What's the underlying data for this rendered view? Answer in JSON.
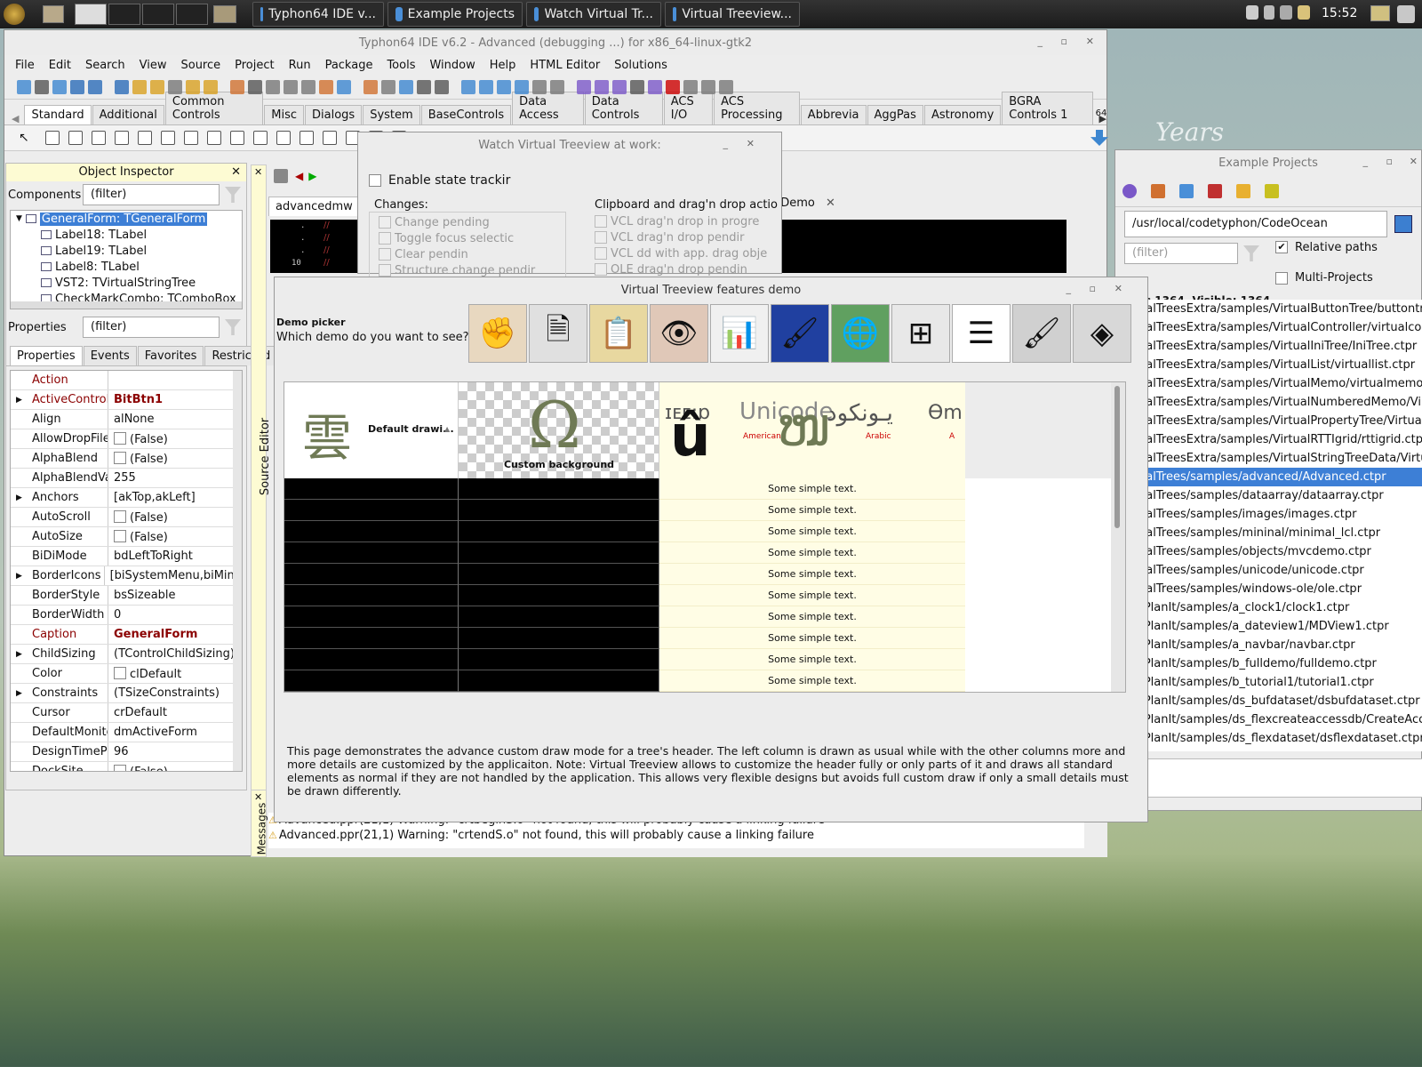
{
  "taskbar": {
    "tasks": [
      {
        "label": "Typhon64 IDE v..."
      },
      {
        "label": "Example Projects"
      },
      {
        "label": "Watch Virtual Tr..."
      },
      {
        "label": "Virtual Treeview..."
      }
    ],
    "clock": "15:52"
  },
  "ide": {
    "title": "Typhon64 IDE v6.2 - Advanced (debugging ...) for x86_64-linux-gtk2",
    "menu": [
      "File",
      "Edit",
      "Search",
      "View",
      "Source",
      "Project",
      "Run",
      "Package",
      "Tools",
      "Window",
      "Help",
      "HTML Editor",
      "Solutions"
    ],
    "palette_tabs": [
      "Standard",
      "Additional",
      "Common Controls",
      "Misc",
      "Dialogs",
      "System",
      "BaseControls",
      "Data Access",
      "Data Controls",
      "ACS I/O",
      "ACS Processing",
      "Abbrevia",
      "AggPas",
      "Astronomy",
      "BGRA Controls 1"
    ],
    "bits_label": "64",
    "editor_tab": "advancedmw",
    "editor_tab2": "neDemo",
    "source_editor_label": "Source Editor",
    "messages_label": "Messages",
    "messages": [
      "Advanced.ppr(21,1) Warning: \"crtbeginS.o\" not found, this will probably cause a linking failure",
      "Advanced.ppr(21,1) Warning: \"crtendS.o\" not found, this will probably cause a linking failure"
    ],
    "gutter": {
      "dot": ".",
      "line10": "10",
      "mark": "//"
    }
  },
  "object_inspector": {
    "title": "Object Inspector",
    "components_label": "Components",
    "filter": "(filter)",
    "tree": [
      "GeneralForm: TGeneralForm",
      "Label18: TLabel",
      "Label19: TLabel",
      "Label8: TLabel",
      "VST2: TVirtualStringTree",
      "CheckMarkCombo: TComboBox"
    ],
    "properties_label": "Properties",
    "tabs": [
      "Properties",
      "Events",
      "Favorites",
      "Restricted"
    ],
    "props": [
      {
        "name": "Action",
        "value": ""
      },
      {
        "name": "ActiveControl",
        "value": "BitBtn1"
      },
      {
        "name": "Align",
        "value": "alNone"
      },
      {
        "name": "AllowDropFiles",
        "value": "(False)"
      },
      {
        "name": "AlphaBlend",
        "value": "(False)"
      },
      {
        "name": "AlphaBlendVal",
        "value": "255"
      },
      {
        "name": "Anchors",
        "value": "[akTop,akLeft]"
      },
      {
        "name": "AutoScroll",
        "value": "(False)"
      },
      {
        "name": "AutoSize",
        "value": "(False)"
      },
      {
        "name": "BiDiMode",
        "value": "bdLeftToRight"
      },
      {
        "name": "BorderIcons",
        "value": "[biSystemMenu,biMinim"
      },
      {
        "name": "BorderStyle",
        "value": "bsSizeable"
      },
      {
        "name": "BorderWidth",
        "value": "0"
      },
      {
        "name": "Caption",
        "value": "GeneralForm"
      },
      {
        "name": "ChildSizing",
        "value": "(TControlChildSizing)"
      },
      {
        "name": "Color",
        "value": "clDefault"
      },
      {
        "name": "Constraints",
        "value": "(TSizeConstraints)"
      },
      {
        "name": "Cursor",
        "value": "crDefault"
      },
      {
        "name": "DefaultMonito",
        "value": "dmActiveForm"
      },
      {
        "name": "DesignTimePP",
        "value": "96"
      },
      {
        "name": "DockSite",
        "value": "(False)"
      }
    ]
  },
  "watch": {
    "title": "Watch Virtual Treeview at work:",
    "enable_label": "Enable state trackir",
    "changes_label": "Changes:",
    "changes": [
      "Change pending",
      "Toggle focus selectic",
      "Clear pendin",
      "Structure change pendir"
    ],
    "clip_label": "Clipboard and drag'n drop actio",
    "clip": [
      "VCL drag'n drop in progre",
      "VCL drag'n drop pendir",
      "VCL dd with app. drag obje",
      "OLE drag'n drop pendin"
    ]
  },
  "demo": {
    "title": "Virtual Treeview features demo",
    "picker_label": "Demo picker",
    "question": "Which demo do you want to see?",
    "header_default": "Default drawi...",
    "header_custom": "Custom background",
    "header_unicode": "Unicode",
    "header_american": "American",
    "header_arabic": "Arabic",
    "header_a": "A",
    "header_glyph1": "雲",
    "header_glyph2": "Ω",
    "header_glyph3": "û",
    "header_glyph4": "ໜ",
    "header_arabic_text": "يـونكود",
    "header_cut": "ɪᴇᴇ:ɒ",
    "header_cut2": "Ѳm",
    "row_text": "Some simple text.",
    "rows": 10,
    "description": "This page demonstrates the advance custom draw mode for a tree's header. The left column is drawn as usual while with the other columns more and more details are customized by the applicaiton. Note: Virtual Treeview allows to customize the header fully or only parts of it and draws all standard elements as normal if they are not handled by the application. This allows very flexible designs but avoids full custom draw if only a small details must be drawn differently."
  },
  "example_projects": {
    "title": "Example Projects",
    "path": "/usr/local/codetyphon/CodeOcean",
    "filter": "(filter)",
    "relative_label": "Relative paths",
    "multi_label": "Multi-Projects",
    "count_label": "ects 1364, Visible: 1364",
    "items": [
      "irtualTreesExtra/samples/VirtualButtonTree/buttontree",
      "irtualTreesExtra/samples/VirtualController/virtualcontr",
      "irtualTreesExtra/samples/VirtualIniTree/IniTree.ctpr",
      "irtualTreesExtra/samples/VirtualList/virtuallist.ctpr",
      "irtualTreesExtra/samples/VirtualMemo/virtualmemo.ct",
      "irtualTreesExtra/samples/VirtualNumberedMemo/Virtu",
      "irtualTreesExtra/samples/VirtualPropertyTree/VirtualPr",
      "irtualTreesExtra/samples/VirtualRTTIgrid/rttigrid.ctpr",
      "irtualTreesExtra/samples/VirtualStringTreeData/Virtual",
      "irtualTrees/samples/advanced/Advanced.ctpr",
      "irtualTrees/samples/dataarray/dataarray.ctpr",
      "irtualTrees/samples/images/images.ctpr",
      "irtualTrees/samples/mininal/minimal_lcl.ctpr",
      "irtualTrees/samples/objects/mvcdemo.ctpr",
      "irtualTrees/samples/unicode/unicode.ctpr",
      "irtualTrees/samples/windows-ole/ole.ctpr",
      "ualPlanIt/samples/a_clock1/clock1.ctpr",
      "ualPlanIt/samples/a_dateview1/MDView1.ctpr",
      "ualPlanIt/samples/a_navbar/navbar.ctpr",
      "ualPlanIt/samples/b_fulldemo/fulldemo.ctpr",
      "ualPlanIt/samples/b_tutorial1/tutorial1.ctpr",
      "ualPlanIt/samples/ds_bufdataset/dsbufdataset.ctpr",
      "ualPlanIt/samples/ds_flexcreateaccessdb/CreateAcce",
      "ualPlanIt/samples/ds_flexdataset/dsflexdataset.ctpr"
    ],
    "selected_index": 9
  },
  "wallpaper_text": "Years",
  "colors": {
    "selection": "#3d7fd6",
    "accent_red": "#8b0000",
    "row_bg": "#fffde5"
  }
}
